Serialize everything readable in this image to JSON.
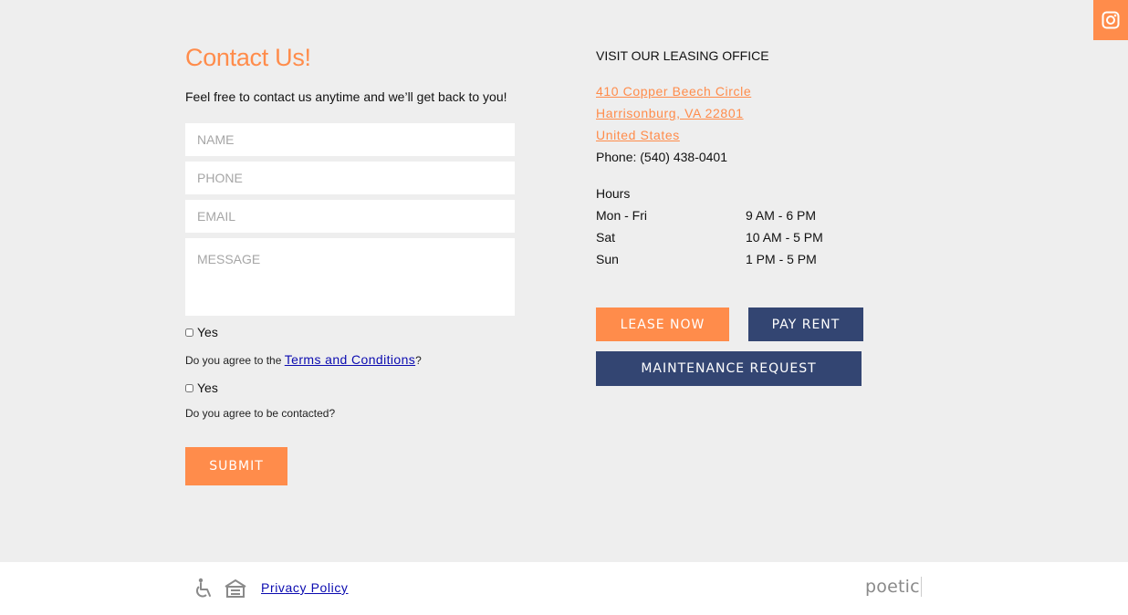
{
  "contact": {
    "title": "Contact Us!",
    "subtitle": "Feel free to contact us anytime and we’ll get back to you!",
    "fields": {
      "name_placeholder": "NAME",
      "phone_placeholder": "PHONE",
      "email_placeholder": "EMAIL",
      "message_placeholder": "MESSAGE"
    },
    "terms_checkbox_label": "Yes",
    "terms_question_prefix": "Do you agree to the ",
    "terms_link": "Terms and Conditions",
    "terms_question_suffix": "?",
    "contact_checkbox_label": "Yes",
    "contact_question": "Do you agree to be contacted?",
    "submit_label": "SUBMIT"
  },
  "office": {
    "heading": "VISIT OUR LEASING OFFICE",
    "address_line1": "410 Copper Beech Circle",
    "address_line2": "Harrisonburg, VA 22801",
    "address_line3": "United States",
    "phone": "Phone: (540) 438-0401",
    "hours_heading": "Hours",
    "hours": [
      {
        "day": "Mon - Fri",
        "time": "9 AM - 6 PM"
      },
      {
        "day": "Sat",
        "time": "10 AM - 5 PM"
      },
      {
        "day": "Sun",
        "time": "1 PM - 5 PM"
      }
    ]
  },
  "actions": {
    "lease_now": "LEASE NOW",
    "pay_rent": "PAY RENT",
    "maintenance": "MAINTENANCE REQUEST"
  },
  "footer": {
    "privacy_policy": "Privacy Policy",
    "brand": "poetic"
  },
  "icons": {
    "social": "instagram-icon",
    "accessibility": "wheelchair-icon",
    "housing": "equal-housing-icon"
  },
  "colors": {
    "accent": "#ff8c4b",
    "navy": "#334572",
    "background": "#eeeeee",
    "link": "#0b0bb0"
  }
}
